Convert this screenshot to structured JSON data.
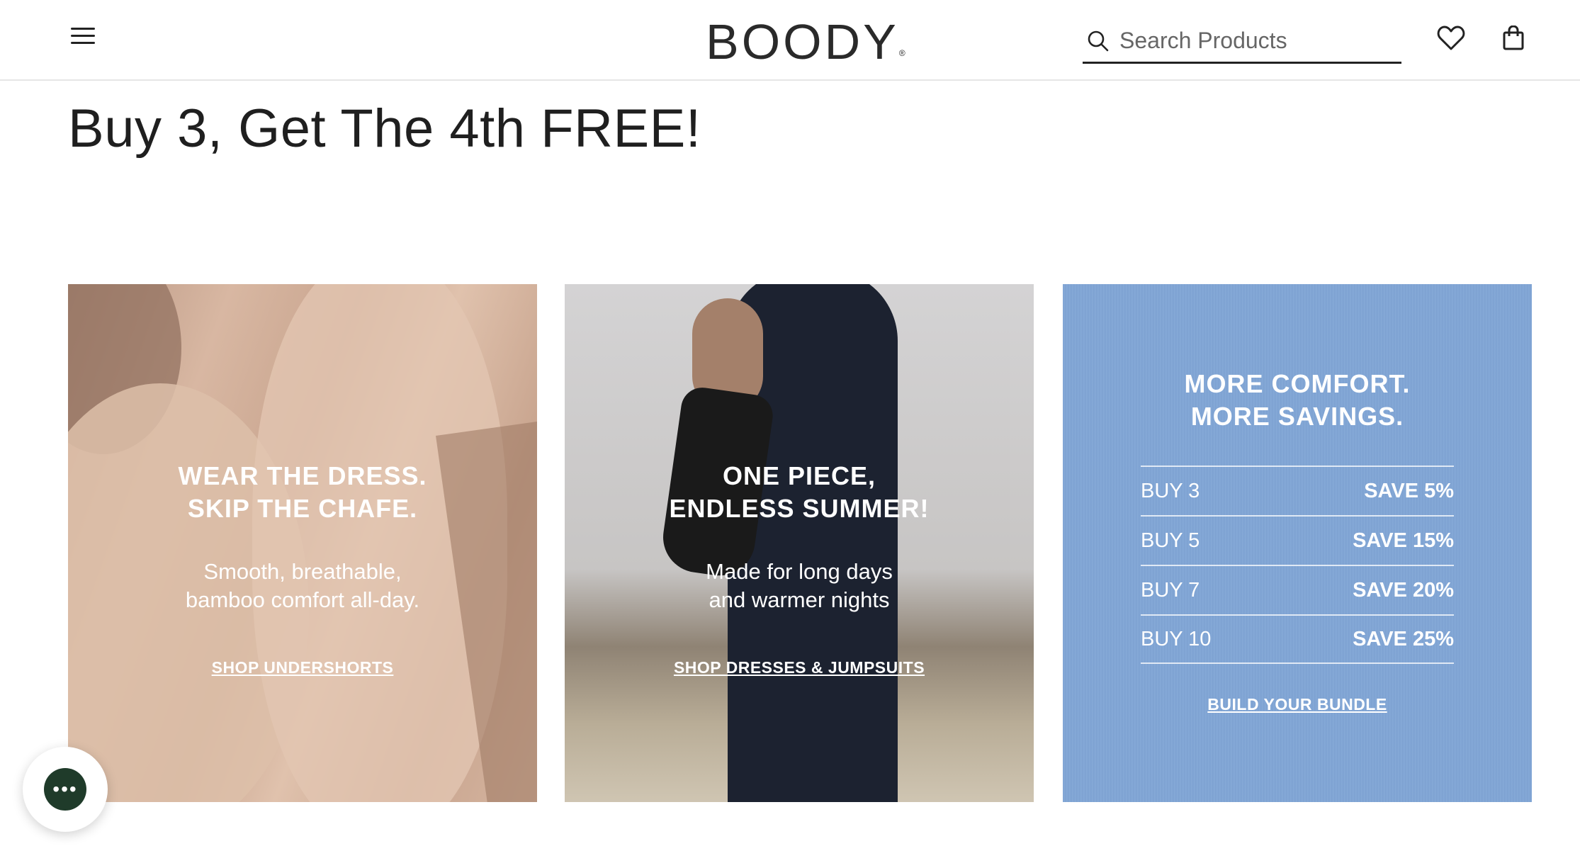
{
  "header": {
    "logo": "BOODY",
    "logo_mark": "®",
    "search_placeholder": "Search Products",
    "icons": [
      "menu-icon",
      "search-icon",
      "heart-icon",
      "bag-icon"
    ]
  },
  "page": {
    "title": "Buy 3, Get The 4th FREE!"
  },
  "cards": [
    {
      "heading_line1": "WEAR THE DRESS.",
      "heading_line2": "SKIP THE CHAFE.",
      "sub_line1": "Smooth, breathable,",
      "sub_line2": "bamboo comfort all-day.",
      "link": "SHOP UNDERSHORTS"
    },
    {
      "heading_line1": "ONE PIECE,",
      "heading_line2": "ENDLESS SUMMER!",
      "sub_line1": "Made for long days",
      "sub_line2": "and warmer nights",
      "link": "SHOP DRESSES & JUMPSUITS"
    },
    {
      "heading_line1": "MORE COMFORT.",
      "heading_line2": "MORE SAVINGS.",
      "rows": [
        {
          "buy": "BUY 3",
          "save": "SAVE 5%"
        },
        {
          "buy": "BUY 5",
          "save": "SAVE 15%"
        },
        {
          "buy": "BUY 7",
          "save": "SAVE 20%"
        },
        {
          "buy": "BUY 10",
          "save": "SAVE 25%"
        }
      ],
      "link": "BUILD YOUR BUNDLE"
    }
  ],
  "chat": {
    "icon": "chat-bubble-icon",
    "dots": "•••"
  },
  "colors": {
    "text": "#222222",
    "card3_bg": "#83a8d6",
    "chat_bg": "#1f3b2a"
  }
}
